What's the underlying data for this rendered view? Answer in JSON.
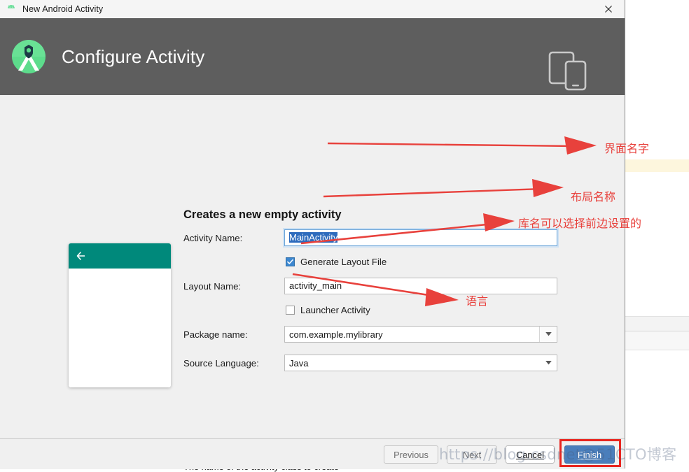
{
  "window": {
    "title": "New Android Activity",
    "app_icon": "android-robot-icon",
    "close_icon": "close-icon"
  },
  "header": {
    "title": "Configure Activity",
    "logo_icon": "android-studio-logo-icon",
    "device_icon": "tablet-phone-icon",
    "background_color": "#5e5e5e"
  },
  "preview": {
    "back_icon": "back-arrow-icon",
    "appbar_color": "#00897b"
  },
  "form": {
    "title": "Creates a new empty activity",
    "fields": [
      {
        "label": "Activity Name:",
        "value": "MainActivity",
        "selected": true
      },
      {
        "label": "Layout Name:",
        "value": "activity_main",
        "selected": false
      },
      {
        "label": "Package name:",
        "value": "com.example.mylibrary",
        "selected": false
      },
      {
        "label": "Source Language:",
        "value": "Java",
        "selected": false
      }
    ],
    "checkboxes": [
      {
        "label": "Generate Layout File",
        "checked": true
      },
      {
        "label": "Launcher Activity",
        "checked": false
      }
    ],
    "help_text": "The name of the activity class to create"
  },
  "footer": {
    "previous_label": "Previous",
    "next_label": "Next",
    "cancel_label": "Cancel",
    "finish_label": "Finish",
    "highlight_color": "#e8251f",
    "primary_color": "#4a7ebb"
  },
  "annotations": {
    "color": "#e8413c",
    "items": [
      {
        "text": "界面名字"
      },
      {
        "text": "布局名称"
      },
      {
        "text": "库名可以选择前边设置的"
      },
      {
        "text": "语言"
      }
    ]
  },
  "watermark": {
    "text": "https://blog.csdnet@51CTO博客"
  }
}
